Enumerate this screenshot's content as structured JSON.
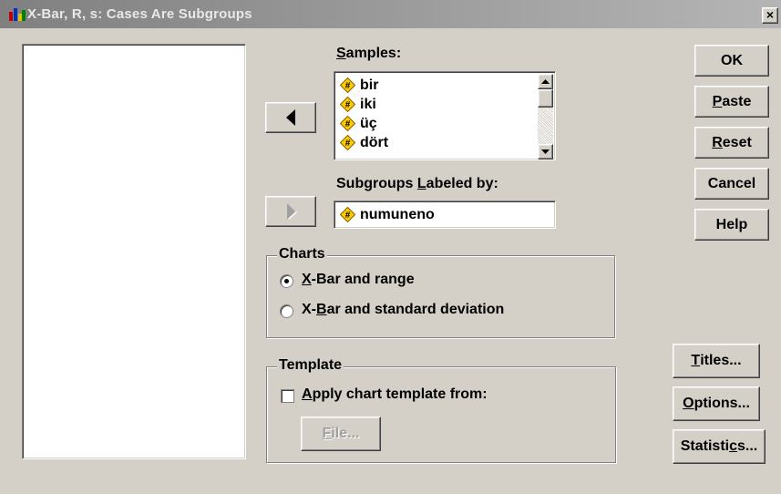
{
  "window": {
    "title": "X-Bar, R, s: Cases Are Subgroups",
    "close_label": "×"
  },
  "samples": {
    "label_pre": "",
    "label_mnemonic": "S",
    "label_post": "amples:",
    "items": [
      "bir",
      "iki",
      "üç",
      "dört"
    ]
  },
  "subgroups": {
    "label_pre": "Subgroups ",
    "label_mnemonic": "L",
    "label_post": "abeled by:",
    "value": "numuneno"
  },
  "charts": {
    "title": "Charts",
    "options": [
      {
        "pre": "",
        "mnemonic": "X",
        "post": "-Bar and range",
        "selected": true
      },
      {
        "pre": "X-",
        "mnemonic": "B",
        "post": "ar and standard deviation",
        "selected": false
      }
    ]
  },
  "template": {
    "title": "Template",
    "checkbox": {
      "pre": "",
      "mnemonic": "A",
      "post": "pply chart template from:",
      "checked": false
    },
    "file_button": {
      "pre": "",
      "mnemonic": "F",
      "post": "ile..."
    }
  },
  "buttons": {
    "ok": {
      "pre": "OK",
      "mnemonic": "",
      "post": ""
    },
    "paste": {
      "pre": "",
      "mnemonic": "P",
      "post": "aste"
    },
    "reset": {
      "pre": "",
      "mnemonic": "R",
      "post": "eset"
    },
    "cancel": {
      "pre": "Cancel",
      "mnemonic": "",
      "post": ""
    },
    "help": {
      "pre": "Help",
      "mnemonic": "",
      "post": ""
    },
    "titles": {
      "pre": "",
      "mnemonic": "T",
      "post": "itles..."
    },
    "options": {
      "pre": "",
      "mnemonic": "O",
      "post": "ptions..."
    },
    "statistics": {
      "pre": "Statisti",
      "mnemonic": "c",
      "post": "s..."
    }
  },
  "colors": {
    "dialog_bg": "#d4d0c8",
    "titlebar_start": "#808080",
    "titlebar_end": "#b5b5b5",
    "var_icon": "#ffcc00"
  }
}
